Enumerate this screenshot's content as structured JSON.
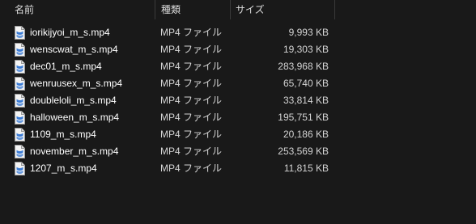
{
  "columns": {
    "name": "名前",
    "type": "種類",
    "size": "サイズ"
  },
  "files": [
    {
      "name": "iorikijyoi_m_s.mp4",
      "type": "MP4 ファイル",
      "size": "9,993 KB",
      "icon": "video-file-icon"
    },
    {
      "name": "wenscwat_m_s.mp4",
      "type": "MP4 ファイル",
      "size": "19,303 KB",
      "icon": "video-file-icon"
    },
    {
      "name": "dec01_m_s.mp4",
      "type": "MP4 ファイル",
      "size": "283,968 KB",
      "icon": "video-file-icon"
    },
    {
      "name": "wenruusex_m_s.mp4",
      "type": "MP4 ファイル",
      "size": "65,740 KB",
      "icon": "video-file-icon"
    },
    {
      "name": "doubleloli_m_s.mp4",
      "type": "MP4 ファイル",
      "size": "33,814 KB",
      "icon": "video-file-icon"
    },
    {
      "name": "halloween_m_s.mp4",
      "type": "MP4 ファイル",
      "size": "195,751 KB",
      "icon": "video-file-icon"
    },
    {
      "name": "1109_m_s.mp4",
      "type": "MP4 ファイル",
      "size": "20,186 KB",
      "icon": "video-file-icon"
    },
    {
      "name": "november_m_s.mp4",
      "type": "MP4 ファイル",
      "size": "253,569 KB",
      "icon": "video-file-icon"
    },
    {
      "name": "1207_m_s.mp4",
      "type": "MP4 ファイル",
      "size": "11,815 KB",
      "icon": "video-file-icon"
    }
  ],
  "colors": {
    "background": "#191919",
    "text": "#ffffff",
    "secondary_text": "#d4d4d4",
    "icon_accent": "#3a7bd5"
  }
}
